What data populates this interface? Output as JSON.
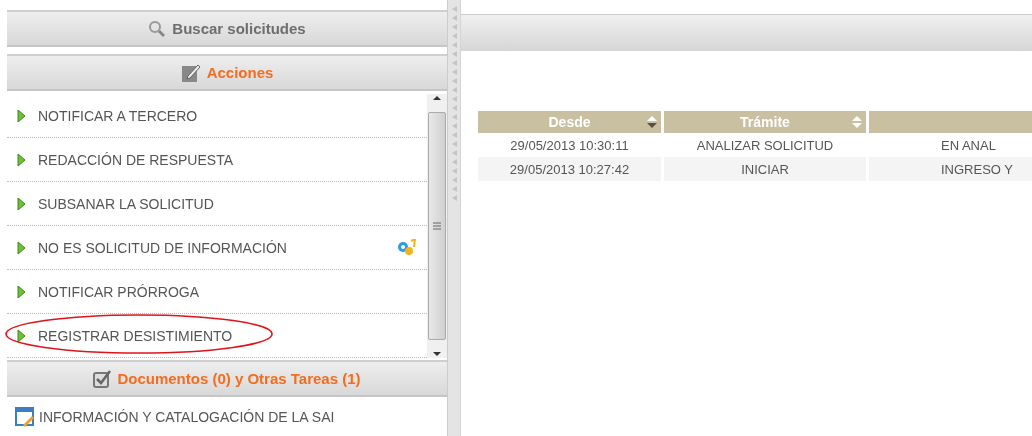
{
  "sidebar": {
    "search_header": {
      "label": "Buscar solicitudes"
    },
    "actions_header": {
      "label": "Acciones"
    },
    "actions": [
      {
        "label": "NOTIFICAR A TERCERO",
        "highlighted": false,
        "badge": false
      },
      {
        "label": "REDACCIÓN DE RESPUESTA",
        "highlighted": false,
        "badge": false
      },
      {
        "label": "SUBSANAR LA SOLICITUD",
        "highlighted": false,
        "badge": false
      },
      {
        "label": "NO ES SOLICITUD DE INFORMACIÓN",
        "highlighted": false,
        "badge": true
      },
      {
        "label": "NOTIFICAR PRÓRROGA",
        "highlighted": false,
        "badge": false
      },
      {
        "label": "REGISTRAR DESISTIMIENTO",
        "highlighted": true,
        "badge": false
      }
    ],
    "documents_header": {
      "label": "Documentos (0) y Otras Tareas (1)"
    },
    "documents": [
      {
        "label": "INFORMACIÓN Y CATALOGACIÓN DE LA SAI"
      }
    ]
  },
  "table": {
    "columns": [
      {
        "label": "Desde",
        "sorted": true
      },
      {
        "label": "Trámite",
        "sorted": false
      }
    ],
    "rows": [
      [
        "29/05/2013 10:30:11",
        "ANALIZAR SOLICITUD",
        "EN ANAL"
      ],
      [
        "29/05/2013 10:27:42",
        "INICIAR",
        "INGRESO Y"
      ]
    ]
  }
}
